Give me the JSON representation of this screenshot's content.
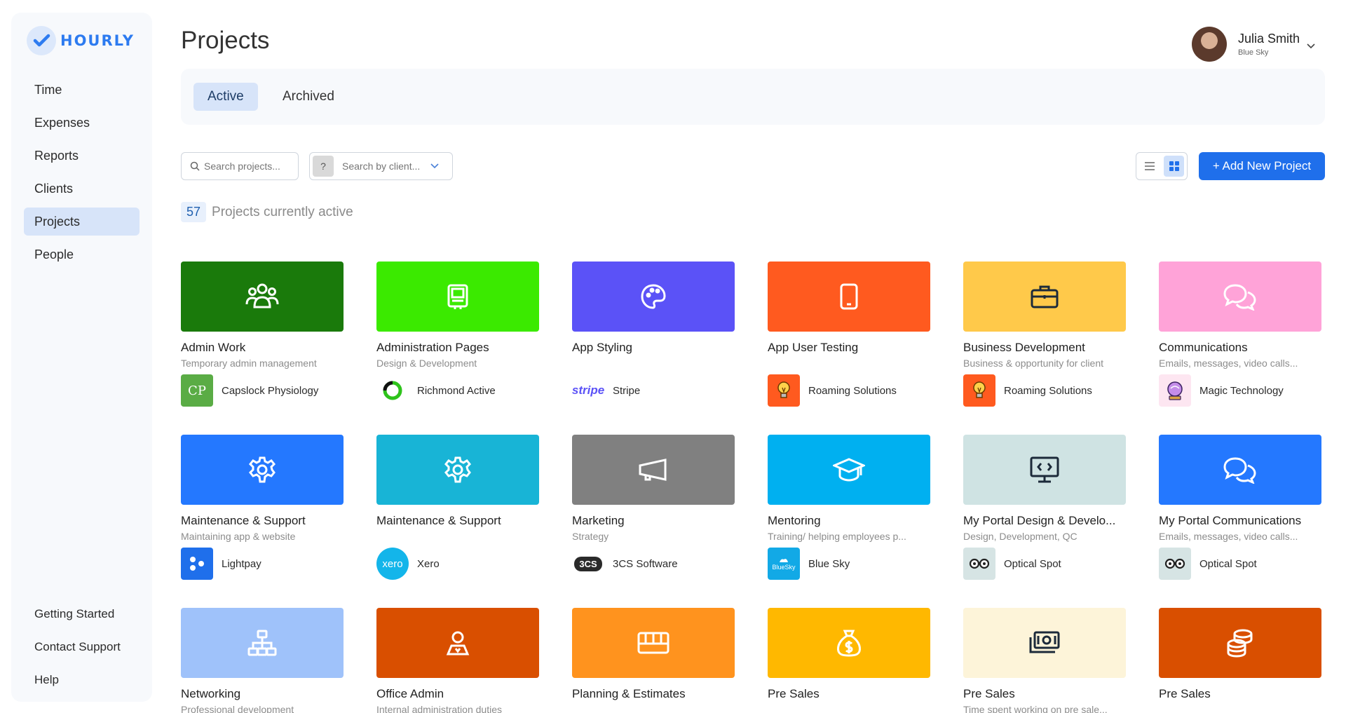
{
  "brand": {
    "name": "HOURLY",
    "accent": "#2d7bf0"
  },
  "sidebar": {
    "items": [
      {
        "label": "Time"
      },
      {
        "label": "Expenses"
      },
      {
        "label": "Reports"
      },
      {
        "label": "Clients"
      },
      {
        "label": "Projects",
        "active": true
      },
      {
        "label": "People"
      }
    ],
    "bottom": [
      {
        "label": "Getting Started"
      },
      {
        "label": "Contact Support"
      },
      {
        "label": "Help"
      }
    ]
  },
  "header": {
    "title": "Projects"
  },
  "user": {
    "name": "Julia Smith",
    "org": "Blue Sky"
  },
  "tabs": [
    {
      "label": "Active",
      "active": true
    },
    {
      "label": "Archived"
    }
  ],
  "toolbar": {
    "search_placeholder": "Search projects...",
    "client_placeholder": "Search by client...",
    "client_prefix": "?",
    "add_label": "+ Add New Project"
  },
  "summary": {
    "count": "57",
    "text": "Projects currently active"
  },
  "projects": [
    {
      "title": "Admin Work",
      "subtitle": "Temporary admin management",
      "color": "#1a7a0b",
      "icon": "people-icon",
      "client": "Capslock Physiology",
      "client_logo": "CP",
      "client_color": "#5aac45"
    },
    {
      "title": "Administration Pages",
      "subtitle": "Design & Development",
      "color": "#3bea00",
      "icon": "monitor-icon",
      "client": "Richmond Active",
      "client_logo": "",
      "client_color": "#ffffff"
    },
    {
      "title": "App Styling",
      "subtitle": "",
      "color": "#5b52f7",
      "icon": "palette-icon",
      "client": "Stripe",
      "client_logo": "stripe",
      "client_color": "#ffffff"
    },
    {
      "title": "App User Testing",
      "subtitle": "",
      "color": "#ff5a1f",
      "icon": "phone-icon",
      "client": "Roaming Solutions",
      "client_logo": "",
      "client_color": "#ff5a1f"
    },
    {
      "title": "Business Development",
      "subtitle": "Business & opportunity for client",
      "color": "#ffc94a",
      "icon": "briefcase-icon",
      "client": "Roaming Solutions",
      "client_logo": "",
      "client_color": "#ff5a1f"
    },
    {
      "title": "Communications",
      "subtitle": "Emails, messages, video calls...",
      "color": "#ffa3d8",
      "icon": "chat-icon",
      "client": "Magic Technology",
      "client_logo": "",
      "client_color": "#fde6f1"
    },
    {
      "title": "Maintenance & Support",
      "subtitle": "Maintaining app & website",
      "color": "#2478ff",
      "icon": "gear-icon",
      "client": "Lightpay",
      "client_logo": "",
      "client_color": "#1f6feb"
    },
    {
      "title": "Maintenance & Support",
      "subtitle": "",
      "color": "#18b4d6",
      "icon": "gear-icon",
      "client": "Xero",
      "client_logo": "xero",
      "client_color": "#13b5ea"
    },
    {
      "title": "Marketing",
      "subtitle": "Strategy",
      "color": "#808080",
      "icon": "megaphone-icon",
      "client": "3CS Software",
      "client_logo": "3CS",
      "client_color": "#2a2a2a"
    },
    {
      "title": "Mentoring",
      "subtitle": "Training/ helping employees p...",
      "color": "#00b0f0",
      "icon": "graduation-cap-icon",
      "client": "Blue Sky",
      "client_logo": "BlueSky",
      "client_color": "#12a9e6"
    },
    {
      "title": "My Portal Design & Develo...",
      "subtitle": "Design, Development, QC",
      "color": "#cfe3e3",
      "icon": "code-monitor-icon",
      "client": "Optical Spot",
      "client_logo": "",
      "client_color": "#d6e4e4"
    },
    {
      "title": "My Portal Communications",
      "subtitle": "Emails, messages, video calls...",
      "color": "#2478ff",
      "icon": "chat-icon",
      "client": "Optical Spot",
      "client_logo": "",
      "client_color": "#d6e4e4"
    },
    {
      "title": "Networking",
      "subtitle": "Professional development",
      "color": "#9fc2fa",
      "icon": "network-icon",
      "client": "",
      "client_logo": "",
      "client_color": ""
    },
    {
      "title": "Office Admin",
      "subtitle": "Internal administration duties",
      "color": "#d94f00",
      "icon": "person-icon",
      "client": "",
      "client_logo": "",
      "client_color": ""
    },
    {
      "title": "Planning & Estimates",
      "subtitle": "",
      "color": "#ff931e",
      "icon": "keyboard-icon",
      "client": "",
      "client_logo": "",
      "client_color": ""
    },
    {
      "title": "Pre Sales",
      "subtitle": "",
      "color": "#ffb800",
      "icon": "money-bag-icon",
      "client": "",
      "client_logo": "",
      "client_color": ""
    },
    {
      "title": "Pre Sales",
      "subtitle": "Time spent working on pre sale...",
      "color": "#fdf4d9",
      "icon": "cash-icon",
      "client": "",
      "client_logo": "",
      "client_color": ""
    },
    {
      "title": "Pre Sales",
      "subtitle": "",
      "color": "#d94f00",
      "icon": "coins-icon",
      "client": "",
      "client_logo": "",
      "client_color": ""
    }
  ]
}
